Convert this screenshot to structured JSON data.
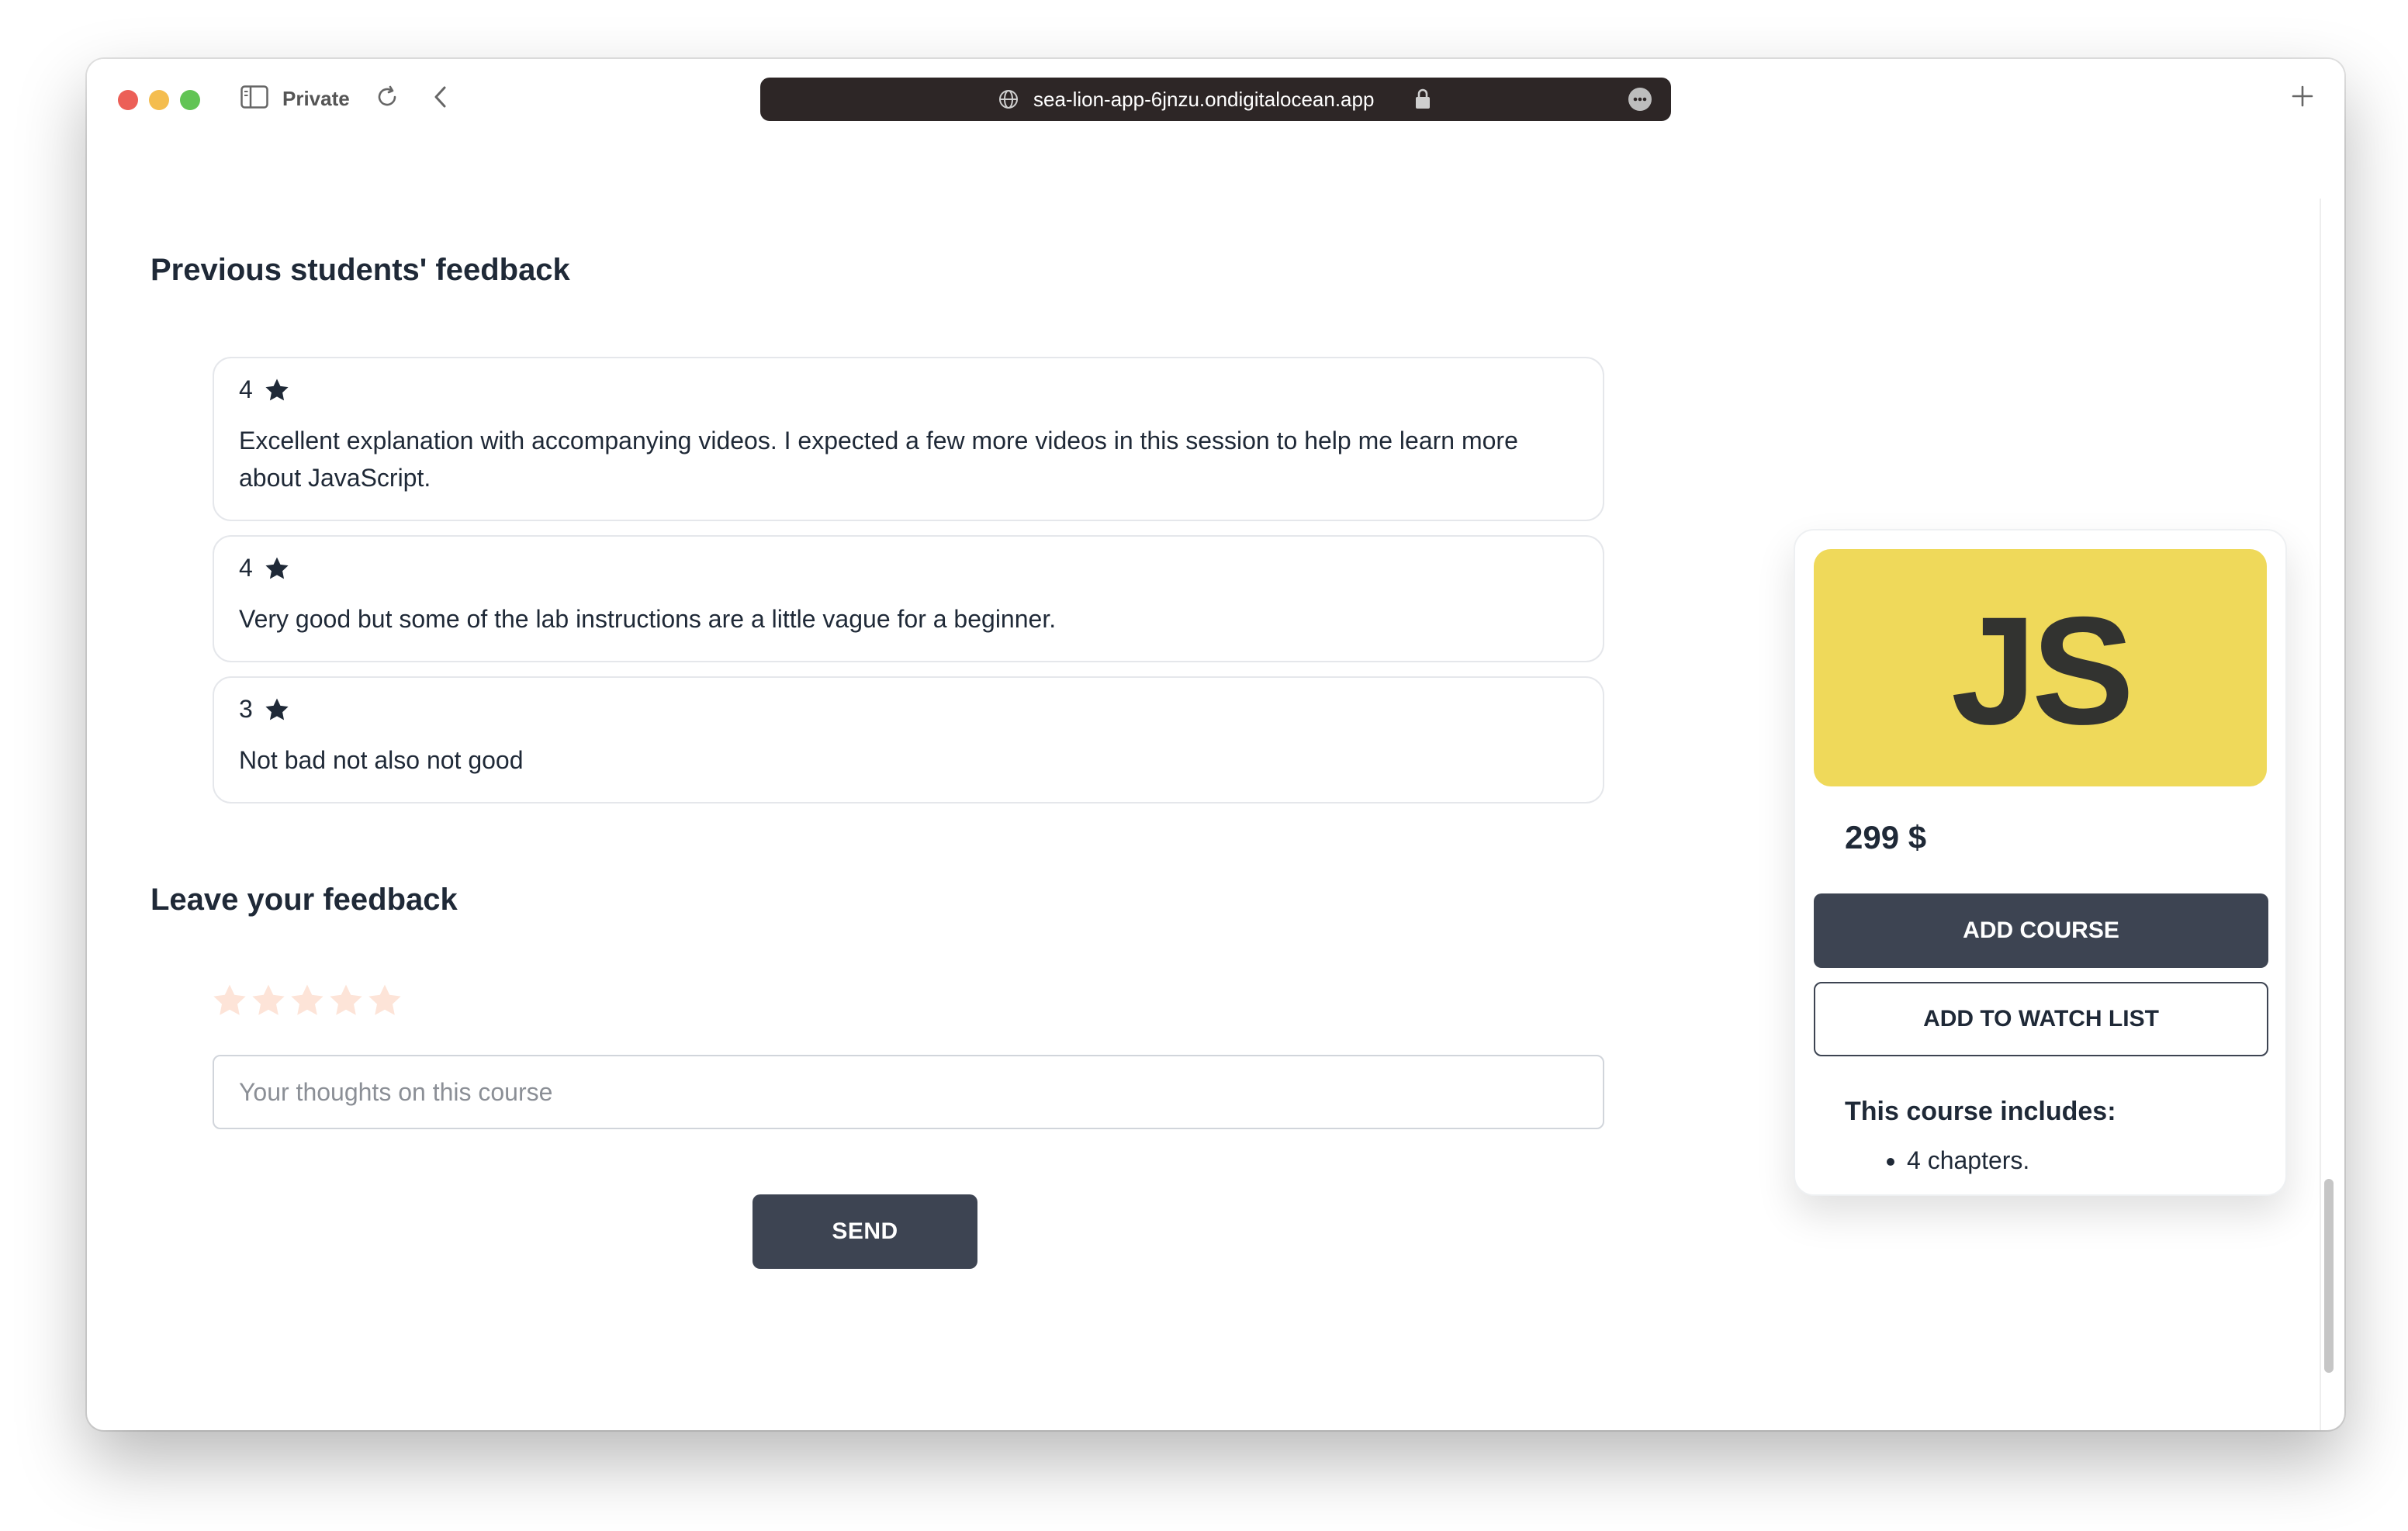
{
  "browser": {
    "private_label": "Private",
    "url": "sea-lion-app-6jnzu.ondigitalocean.app"
  },
  "feedback": {
    "previous_title": "Previous students' feedback",
    "reviews": [
      {
        "rating": "4",
        "text": "Excellent explanation with accompanying videos. I expected a few more videos in this session to help me learn more about JavaScript."
      },
      {
        "rating": "4",
        "text": "Very good but some of the lab instructions are a little vague for a beginner."
      },
      {
        "rating": "3",
        "text": "Not bad not also not good"
      }
    ],
    "leave_title": "Leave your feedback",
    "selected_stars": 0,
    "max_stars": 5,
    "input_placeholder": "Your thoughts on this course",
    "input_value": "",
    "send_label": "SEND"
  },
  "course": {
    "logo_text": "JS",
    "price": "299 $",
    "add_course_label": "ADD COURSE",
    "watch_list_label": "ADD TO WATCH LIST",
    "includes_title": "This course includes:",
    "includes_items": [
      "4 chapters."
    ]
  },
  "colors": {
    "primary_button": "#3d4452",
    "js_yellow": "#efd95a",
    "star_filled": "#1f2937",
    "star_empty": "#fde4d8"
  }
}
